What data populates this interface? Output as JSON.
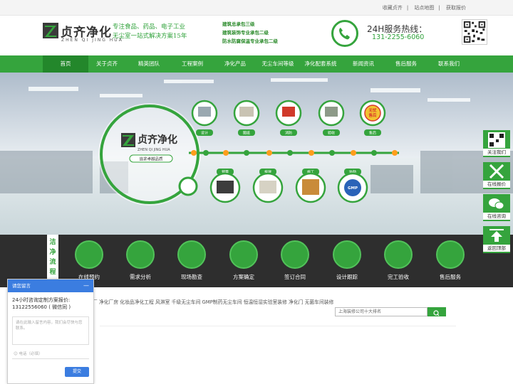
{
  "topbar": {
    "links": [
      "收藏贞齐",
      "站点地图",
      "获取报价"
    ]
  },
  "header": {
    "logo_cn": "贞齐净化",
    "logo_en": "ZHEN QI JING HUA",
    "slogan_line1": "专注食品、药品、电子工业",
    "slogan_line2": "无尘室一站式解决方案15年",
    "certs": [
      "建筑总承包三级",
      "建筑装饰专业承包二级",
      "防水防腐保温专业承包二级"
    ],
    "hotline_title": "24H服务热线：",
    "hotline_number": "131-2255-6060"
  },
  "nav": {
    "items": [
      "首页",
      "关于贞齐",
      "精英团队",
      "工程案例",
      "净化产品",
      "无尘车间等级",
      "净化配套系统",
      "新闻资讯",
      "售后服务",
      "联系我们"
    ]
  },
  "banner": {
    "logo_cn": "贞齐净化",
    "logo_en": "ZHEN QI JING HUA",
    "tagline": "追求卓越品质",
    "top_stages": [
      "设计",
      "图纸",
      "消防",
      "验收",
      "售后"
    ],
    "bottom_stages": [
      "预算",
      "报建",
      "施工",
      "协助"
    ],
    "badge_text": [
      "无忧",
      "售后"
    ],
    "gmp": "GMP"
  },
  "process": {
    "tag": "洁净流程",
    "steps": [
      "在线预约",
      "需求分析",
      "现场勘查",
      "方案确定",
      "签订合同",
      "设计跟踪",
      "完工验收",
      "售后服务"
    ]
  },
  "keywords": "厂 净化厂房 化妆品净化工程 风淋室 千级无尘车间 GMP制药无尘车间 恒温恒湿实验室装修 净化门 无菌车间装修",
  "search": {
    "placeholder": "上海装修公司十大排名"
  },
  "sidebar": {
    "items": [
      "关注我们",
      "在线报价",
      "在线咨询",
      "返回顶部"
    ]
  },
  "chat": {
    "title": "请您留言",
    "minimize": "—",
    "message": "24小时咨询定制方案报价: 13122556060 ( 微信同 )",
    "textarea_placeholder": "请在此输入留言内容，我们会尽快与您联系。",
    "phone_placeholder": "电话（必填）",
    "submit": "提交"
  },
  "colors": {
    "brand_green": "#35a43d",
    "nav_active": "#23872b",
    "dark_band": "#2e2e2e",
    "chat_blue": "#3b7de0"
  }
}
